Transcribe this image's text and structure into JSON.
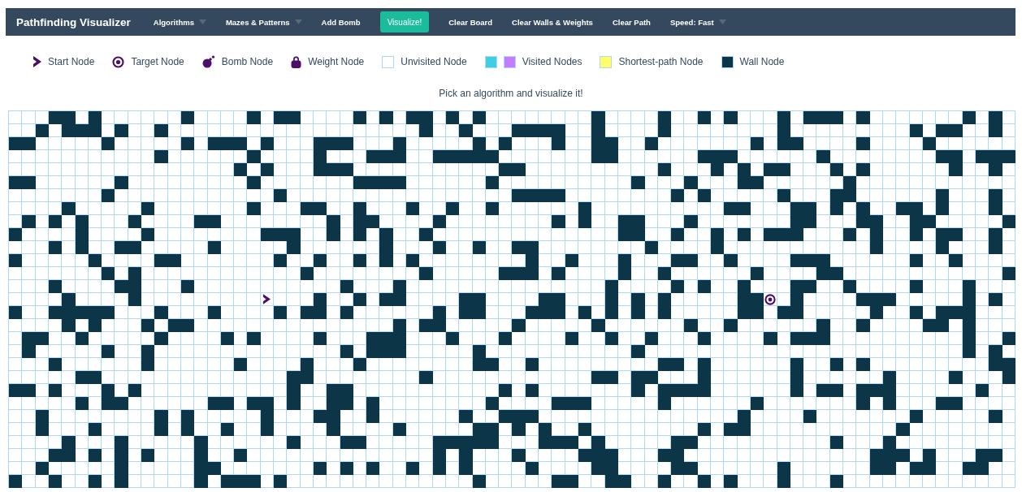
{
  "navbar": {
    "brand": "Pathfinding Visualizer",
    "items": [
      {
        "label": "Algorithms",
        "kind": "dropdown"
      },
      {
        "label": "Mazes & Patterns",
        "kind": "dropdown"
      },
      {
        "label": "Add Bomb",
        "kind": "link"
      },
      {
        "label": "Visualize!",
        "kind": "primary"
      },
      {
        "label": "Clear Board",
        "kind": "link"
      },
      {
        "label": "Clear Walls & Weights",
        "kind": "link"
      },
      {
        "label": "Clear Path",
        "kind": "link"
      },
      {
        "label": "Speed: Fast",
        "kind": "dropdown"
      }
    ]
  },
  "legend": [
    {
      "label": "Start Node",
      "kind": "start"
    },
    {
      "label": "Target Node",
      "kind": "target"
    },
    {
      "label": "Bomb Node",
      "kind": "bomb"
    },
    {
      "label": "Weight Node",
      "kind": "weight"
    },
    {
      "label": "Unvisited Node",
      "kind": "swatch",
      "swatches": [
        {
          "color": "#ffffff"
        }
      ]
    },
    {
      "label": "Visited Nodes",
      "kind": "swatch",
      "swatches": [
        {
          "color": "#40cee3"
        },
        {
          "color": "#c57dff"
        }
      ]
    },
    {
      "label": "Shortest-path Node",
      "kind": "swatch",
      "swatches": [
        {
          "color": "#fffe6a"
        }
      ]
    },
    {
      "label": "Wall Node",
      "kind": "swatch",
      "swatches": [
        {
          "color": "#0c3547"
        }
      ]
    }
  ],
  "instruction": "Pick an algorithm and visualize it!",
  "grid": {
    "rows": [
      [
        false,
        false,
        false,
        true,
        true,
        false,
        true,
        false,
        false,
        false,
        false,
        false,
        false,
        true,
        false,
        false,
        false,
        false,
        true,
        false,
        true,
        true,
        false,
        false,
        false,
        false,
        true,
        false,
        true,
        false,
        true,
        true,
        false,
        true,
        false,
        true,
        false,
        false,
        false,
        false,
        false,
        false,
        false,
        false,
        true,
        false,
        false,
        false,
        false,
        true,
        false,
        false,
        true,
        false,
        true,
        false,
        false,
        false,
        true,
        false,
        true,
        true,
        true,
        false,
        true,
        false,
        false,
        false,
        false,
        false,
        false,
        false,
        true,
        false,
        true,
        false
      ],
      [
        false,
        false,
        true,
        false,
        true,
        true,
        true,
        false,
        true,
        false,
        false,
        true,
        false,
        false,
        false,
        false,
        false,
        false,
        false,
        false,
        false,
        false,
        false,
        false,
        false,
        false,
        false,
        false,
        false,
        false,
        false,
        true,
        false,
        false,
        true,
        false,
        false,
        false,
        true,
        true,
        true,
        true,
        false,
        false,
        true,
        false,
        false,
        false,
        false,
        true,
        false,
        false,
        false,
        false,
        false,
        false,
        false,
        false,
        true,
        false,
        false,
        false,
        false,
        false,
        false,
        false,
        false,
        false,
        true,
        false,
        true,
        true,
        false,
        false,
        true,
        false
      ],
      [
        true,
        true,
        false,
        false,
        false,
        false,
        false,
        true,
        false,
        false,
        false,
        false,
        false,
        true,
        false,
        true,
        true,
        true,
        false,
        true,
        false,
        false,
        false,
        true,
        true,
        true,
        false,
        false,
        false,
        true,
        false,
        false,
        false,
        false,
        false,
        true,
        false,
        true,
        false,
        false,
        false,
        true,
        false,
        false,
        true,
        true,
        false,
        false,
        true,
        false,
        false,
        false,
        false,
        false,
        false,
        false,
        true,
        false,
        true,
        true,
        false,
        false,
        false,
        false,
        true,
        false,
        false,
        false,
        false,
        true,
        false,
        false,
        false,
        false,
        false,
        false
      ],
      [
        false,
        false,
        false,
        false,
        false,
        false,
        false,
        false,
        false,
        false,
        false,
        true,
        false,
        false,
        false,
        false,
        false,
        false,
        true,
        false,
        false,
        false,
        false,
        true,
        false,
        false,
        false,
        true,
        true,
        true,
        false,
        false,
        true,
        true,
        true,
        true,
        true,
        false,
        false,
        false,
        false,
        false,
        false,
        false,
        true,
        true,
        false,
        false,
        false,
        false,
        false,
        false,
        true,
        true,
        true,
        false,
        false,
        false,
        false,
        false,
        false,
        true,
        false,
        false,
        false,
        false,
        false,
        false,
        false,
        false,
        true,
        true,
        false,
        true,
        true,
        true
      ],
      [
        false,
        false,
        false,
        false,
        false,
        false,
        false,
        false,
        false,
        false,
        false,
        false,
        false,
        false,
        false,
        false,
        false,
        true,
        false,
        true,
        false,
        false,
        false,
        true,
        true,
        true,
        false,
        false,
        false,
        false,
        false,
        false,
        false,
        false,
        false,
        false,
        false,
        true,
        true,
        false,
        false,
        false,
        false,
        false,
        false,
        false,
        false,
        false,
        false,
        true,
        false,
        false,
        false,
        true,
        false,
        true,
        false,
        true,
        true,
        false,
        false,
        false,
        true,
        false,
        true,
        false,
        false,
        false,
        false,
        false,
        false,
        true,
        false,
        false,
        true,
        false
      ],
      [
        true,
        true,
        false,
        false,
        false,
        false,
        false,
        false,
        true,
        false,
        false,
        false,
        false,
        false,
        false,
        false,
        false,
        false,
        true,
        false,
        false,
        false,
        false,
        false,
        false,
        false,
        true,
        true,
        true,
        true,
        false,
        false,
        false,
        false,
        false,
        false,
        true,
        false,
        false,
        false,
        false,
        false,
        false,
        false,
        false,
        false,
        false,
        true,
        false,
        false,
        false,
        true,
        false,
        false,
        false,
        true,
        true,
        false,
        false,
        false,
        false,
        false,
        false,
        true,
        false,
        false,
        false,
        false,
        false,
        false,
        false,
        false,
        false,
        false,
        false,
        false
      ],
      [
        false,
        false,
        false,
        false,
        false,
        false,
        false,
        true,
        false,
        false,
        false,
        false,
        false,
        false,
        false,
        false,
        false,
        false,
        false,
        false,
        true,
        false,
        false,
        false,
        false,
        false,
        false,
        false,
        false,
        false,
        false,
        false,
        false,
        false,
        false,
        false,
        false,
        false,
        true,
        true,
        true,
        true,
        false,
        false,
        false,
        false,
        false,
        false,
        false,
        false,
        true,
        false,
        true,
        false,
        false,
        false,
        false,
        false,
        true,
        false,
        false,
        false,
        true,
        true,
        false,
        false,
        false,
        false,
        false,
        false,
        true,
        false,
        false,
        false,
        true,
        false
      ],
      [
        false,
        false,
        false,
        false,
        true,
        false,
        false,
        false,
        false,
        false,
        true,
        false,
        false,
        false,
        false,
        false,
        false,
        false,
        true,
        false,
        false,
        false,
        true,
        true,
        false,
        false,
        true,
        false,
        false,
        false,
        true,
        false,
        false,
        true,
        false,
        false,
        true,
        false,
        false,
        false,
        false,
        false,
        false,
        true,
        false,
        false,
        false,
        false,
        false,
        false,
        false,
        false,
        false,
        false,
        true,
        true,
        false,
        false,
        false,
        true,
        true,
        false,
        true,
        false,
        true,
        false,
        false,
        true,
        true,
        false,
        true,
        false,
        false,
        false,
        true,
        false
      ],
      [
        false,
        true,
        false,
        true,
        false,
        true,
        false,
        false,
        false,
        true,
        false,
        false,
        false,
        false,
        true,
        true,
        false,
        false,
        false,
        false,
        false,
        false,
        false,
        false,
        true,
        false,
        true,
        true,
        false,
        false,
        false,
        false,
        true,
        false,
        false,
        false,
        false,
        false,
        false,
        false,
        false,
        true,
        false,
        true,
        false,
        false,
        true,
        true,
        false,
        false,
        false,
        true,
        false,
        false,
        false,
        false,
        false,
        false,
        false,
        true,
        true,
        false,
        false,
        false,
        true,
        true,
        false,
        false,
        true,
        true,
        false,
        false,
        false,
        false,
        false,
        true
      ],
      [
        true,
        false,
        false,
        false,
        false,
        true,
        false,
        false,
        false,
        false,
        true,
        false,
        false,
        false,
        false,
        false,
        false,
        false,
        false,
        true,
        true,
        true,
        false,
        false,
        true,
        false,
        true,
        false,
        true,
        false,
        false,
        true,
        false,
        false,
        false,
        false,
        false,
        false,
        false,
        false,
        false,
        false,
        false,
        false,
        false,
        false,
        true,
        true,
        false,
        false,
        true,
        false,
        false,
        true,
        false,
        true,
        false,
        true,
        true,
        true,
        false,
        false,
        false,
        true,
        false,
        true,
        false,
        false,
        true,
        false,
        true,
        true,
        false,
        false,
        true,
        false
      ],
      [
        false,
        false,
        false,
        true,
        false,
        true,
        false,
        false,
        true,
        true,
        false,
        false,
        false,
        false,
        false,
        true,
        false,
        false,
        false,
        false,
        false,
        true,
        false,
        false,
        false,
        false,
        false,
        false,
        true,
        false,
        false,
        false,
        true,
        false,
        false,
        true,
        false,
        false,
        true,
        true,
        false,
        false,
        false,
        false,
        false,
        false,
        false,
        false,
        true,
        false,
        false,
        false,
        false,
        true,
        false,
        false,
        false,
        false,
        false,
        false,
        false,
        false,
        false,
        false,
        false,
        true,
        false,
        false,
        false,
        false,
        true,
        false,
        false,
        false,
        true,
        false
      ],
      [
        true,
        false,
        false,
        false,
        false,
        false,
        true,
        false,
        false,
        false,
        false,
        true,
        true,
        false,
        false,
        false,
        false,
        false,
        false,
        false,
        true,
        false,
        false,
        true,
        false,
        false,
        true,
        false,
        true,
        false,
        true,
        false,
        false,
        false,
        false,
        false,
        false,
        false,
        false,
        true,
        false,
        false,
        true,
        false,
        false,
        false,
        true,
        false,
        false,
        false,
        true,
        true,
        false,
        false,
        true,
        false,
        false,
        false,
        false,
        true,
        true,
        true,
        false,
        false,
        false,
        false,
        false,
        false,
        true,
        false,
        false,
        true,
        false,
        false,
        false,
        false
      ],
      [
        false,
        false,
        false,
        false,
        false,
        false,
        false,
        true,
        false,
        true,
        false,
        false,
        false,
        false,
        false,
        false,
        false,
        false,
        false,
        false,
        false,
        false,
        true,
        false,
        false,
        false,
        false,
        false,
        false,
        false,
        false,
        true,
        false,
        false,
        false,
        false,
        false,
        true,
        true,
        true,
        false,
        true,
        false,
        false,
        false,
        false,
        true,
        false,
        false,
        true,
        false,
        false,
        false,
        false,
        false,
        false,
        true,
        false,
        false,
        false,
        false,
        true,
        true,
        false,
        false,
        false,
        false,
        false,
        false,
        false,
        false,
        false,
        false,
        false,
        false,
        true
      ],
      [
        false,
        false,
        false,
        true,
        false,
        false,
        false,
        false,
        true,
        true,
        false,
        false,
        false,
        true,
        false,
        false,
        false,
        false,
        false,
        false,
        false,
        false,
        false,
        false,
        false,
        true,
        false,
        false,
        false,
        true,
        false,
        false,
        false,
        false,
        false,
        false,
        false,
        false,
        false,
        false,
        false,
        false,
        false,
        false,
        false,
        true,
        false,
        false,
        false,
        false,
        true,
        false,
        true,
        false,
        false,
        true,
        false,
        false,
        false,
        true,
        true,
        false,
        false,
        true,
        false,
        false,
        false,
        false,
        true,
        false,
        false,
        false,
        true,
        false,
        false,
        false
      ],
      [
        false,
        false,
        false,
        false,
        true,
        false,
        false,
        false,
        false,
        true,
        false,
        false,
        false,
        false,
        false,
        false,
        false,
        false,
        false,
        {
          "kind": "start"
        },
        false,
        false,
        false,
        true,
        false,
        false,
        true,
        false,
        true,
        true,
        false,
        false,
        false,
        false,
        true,
        true,
        false,
        false,
        false,
        false,
        true,
        true,
        false,
        false,
        false,
        true,
        false,
        true,
        false,
        true,
        false,
        false,
        false,
        false,
        false,
        true,
        true,
        {
          "kind": "target"
        },
        false,
        true,
        false,
        false,
        false,
        false,
        true,
        true,
        true,
        false,
        false,
        false,
        false,
        false,
        true,
        false,
        true,
        false
      ],
      [
        true,
        false,
        false,
        true,
        true,
        true,
        true,
        true,
        false,
        false,
        false,
        true,
        false,
        false,
        false,
        true,
        false,
        false,
        false,
        false,
        true,
        false,
        true,
        true,
        false,
        true,
        false,
        false,
        false,
        false,
        false,
        false,
        true,
        false,
        true,
        true,
        false,
        false,
        false,
        true,
        true,
        true,
        false,
        true,
        false,
        true,
        false,
        true,
        false,
        true,
        false,
        false,
        false,
        false,
        false,
        true,
        true,
        false,
        true,
        true,
        false,
        false,
        false,
        false,
        false,
        true,
        false,
        false,
        true,
        false,
        true,
        true,
        true,
        false,
        false,
        false
      ],
      [
        false,
        false,
        false,
        false,
        true,
        false,
        true,
        false,
        false,
        false,
        true,
        false,
        true,
        true,
        false,
        false,
        false,
        false,
        false,
        false,
        false,
        false,
        false,
        false,
        false,
        false,
        false,
        false,
        false,
        true,
        false,
        true,
        true,
        false,
        false,
        false,
        false,
        false,
        true,
        false,
        false,
        false,
        false,
        false,
        true,
        false,
        false,
        false,
        false,
        false,
        false,
        true,
        false,
        false,
        true,
        false,
        false,
        false,
        false,
        false,
        false,
        true,
        false,
        false,
        true,
        false,
        false,
        false,
        false,
        true,
        true,
        false,
        true,
        false,
        false,
        false
      ],
      [
        false,
        true,
        true,
        false,
        false,
        true,
        false,
        false,
        false,
        false,
        false,
        true,
        false,
        false,
        false,
        false,
        true,
        false,
        true,
        false,
        false,
        false,
        false,
        true,
        false,
        false,
        false,
        true,
        true,
        true,
        false,
        false,
        false,
        true,
        false,
        false,
        false,
        true,
        false,
        false,
        false,
        false,
        true,
        false,
        false,
        true,
        false,
        false,
        true,
        false,
        false,
        false,
        true,
        false,
        false,
        false,
        false,
        true,
        false,
        true,
        true,
        true,
        false,
        false,
        false,
        false,
        false,
        false,
        false,
        false,
        false,
        false,
        true,
        false,
        false,
        true
      ],
      [
        false,
        true,
        false,
        false,
        false,
        false,
        false,
        true,
        false,
        false,
        true,
        false,
        false,
        false,
        false,
        false,
        false,
        false,
        false,
        false,
        false,
        false,
        false,
        false,
        false,
        true,
        false,
        true,
        true,
        true,
        false,
        false,
        false,
        false,
        false,
        true,
        false,
        false,
        false,
        false,
        false,
        false,
        false,
        false,
        false,
        false,
        false,
        true,
        false,
        false,
        false,
        false,
        false,
        false,
        false,
        false,
        false,
        false,
        false,
        false,
        false,
        false,
        false,
        false,
        false,
        false,
        false,
        false,
        false,
        false,
        false,
        false,
        true,
        false,
        true,
        false
      ],
      [
        false,
        false,
        false,
        true,
        false,
        false,
        false,
        false,
        false,
        false,
        true,
        false,
        false,
        false,
        false,
        false,
        false,
        true,
        false,
        false,
        false,
        false,
        true,
        false,
        false,
        false,
        true,
        false,
        false,
        false,
        false,
        false,
        false,
        false,
        false,
        true,
        true,
        false,
        false,
        true,
        false,
        false,
        false,
        false,
        false,
        false,
        false,
        false,
        false,
        true,
        true,
        false,
        true,
        false,
        false,
        false,
        false,
        false,
        false,
        true,
        false,
        false,
        true,
        false,
        true,
        false,
        false,
        false,
        false,
        false,
        false,
        false,
        false,
        false,
        true,
        true
      ],
      [
        false,
        false,
        false,
        false,
        false,
        true,
        true,
        false,
        false,
        false,
        false,
        false,
        false,
        false,
        false,
        false,
        false,
        false,
        false,
        false,
        false,
        true,
        true,
        false,
        false,
        false,
        false,
        false,
        false,
        false,
        false,
        true,
        false,
        false,
        false,
        false,
        false,
        false,
        false,
        false,
        false,
        false,
        false,
        false,
        true,
        true,
        false,
        true,
        true,
        false,
        false,
        false,
        true,
        false,
        false,
        false,
        false,
        false,
        false,
        true,
        false,
        false,
        false,
        false,
        false,
        false,
        true,
        false,
        false,
        false,
        false,
        true,
        false,
        false,
        false,
        true
      ],
      [
        true,
        true,
        false,
        true,
        false,
        false,
        false,
        true,
        false,
        true,
        false,
        false,
        false,
        false,
        false,
        false,
        false,
        false,
        false,
        false,
        false,
        true,
        false,
        false,
        true,
        true,
        false,
        false,
        false,
        false,
        false,
        false,
        false,
        false,
        false,
        false,
        false,
        true,
        false,
        true,
        false,
        false,
        false,
        false,
        false,
        false,
        false,
        true,
        false,
        true,
        true,
        true,
        true,
        false,
        false,
        false,
        false,
        false,
        false,
        true,
        false,
        true,
        true,
        false,
        true,
        true,
        true,
        false,
        false,
        false,
        false,
        false,
        false,
        true,
        false,
        false
      ],
      [
        false,
        false,
        false,
        false,
        false,
        true,
        false,
        true,
        true,
        false,
        false,
        false,
        false,
        false,
        false,
        true,
        true,
        false,
        true,
        true,
        false,
        true,
        false,
        false,
        true,
        true,
        false,
        true,
        false,
        false,
        false,
        false,
        false,
        false,
        false,
        false,
        true,
        false,
        false,
        false,
        false,
        true,
        true,
        true,
        false,
        false,
        false,
        false,
        false,
        true,
        false,
        false,
        false,
        false,
        false,
        false,
        true,
        false,
        false,
        false,
        false,
        false,
        false,
        false,
        true,
        false,
        true,
        false,
        false,
        false,
        true,
        true,
        false,
        false,
        false,
        false
      ],
      [
        false,
        false,
        true,
        false,
        false,
        false,
        false,
        false,
        false,
        false,
        false,
        true,
        false,
        true,
        false,
        false,
        false,
        false,
        false,
        true,
        false,
        false,
        false,
        true,
        true,
        false,
        false,
        true,
        false,
        false,
        false,
        false,
        false,
        false,
        true,
        false,
        false,
        true,
        true,
        true,
        false,
        false,
        false,
        false,
        false,
        false,
        false,
        false,
        false,
        false,
        false,
        false,
        false,
        false,
        false,
        true,
        false,
        false,
        false,
        false,
        true,
        false,
        false,
        false,
        false,
        false,
        false,
        false,
        true,
        false,
        false,
        false,
        false,
        false,
        true,
        false
      ],
      [
        false,
        false,
        true,
        false,
        false,
        false,
        true,
        false,
        false,
        false,
        false,
        true,
        false,
        true,
        false,
        false,
        true,
        false,
        false,
        true,
        false,
        false,
        false,
        false,
        true,
        false,
        false,
        false,
        false,
        true,
        false,
        false,
        false,
        false,
        false,
        true,
        true,
        false,
        true,
        false,
        true,
        false,
        false,
        true,
        false,
        false,
        false,
        false,
        false,
        false,
        false,
        false,
        true,
        false,
        true,
        true,
        false,
        false,
        false,
        false,
        false,
        false,
        false,
        false,
        false,
        false,
        false,
        true,
        false,
        false,
        false,
        false,
        false,
        false,
        false,
        false
      ],
      [
        false,
        false,
        false,
        false,
        true,
        false,
        false,
        false,
        true,
        false,
        false,
        false,
        false,
        false,
        true,
        false,
        false,
        false,
        false,
        false,
        false,
        true,
        false,
        false,
        false,
        true,
        true,
        false,
        false,
        false,
        false,
        false,
        true,
        true,
        true,
        true,
        true,
        false,
        false,
        false,
        true,
        true,
        true,
        false,
        true,
        false,
        false,
        false,
        false,
        false,
        true,
        true,
        false,
        false,
        false,
        false,
        false,
        false,
        false,
        false,
        false,
        false,
        true,
        false,
        false,
        false,
        true,
        false,
        false,
        false,
        false,
        false,
        false,
        false,
        false,
        false
      ],
      [
        false,
        false,
        false,
        true,
        true,
        false,
        true,
        false,
        true,
        false,
        true,
        false,
        false,
        false,
        true,
        false,
        false,
        true,
        false,
        false,
        false,
        false,
        false,
        false,
        false,
        false,
        false,
        false,
        false,
        false,
        false,
        false,
        true,
        false,
        true,
        false,
        false,
        false,
        true,
        false,
        false,
        false,
        false,
        true,
        true,
        true,
        false,
        false,
        false,
        true,
        true,
        false,
        false,
        false,
        false,
        false,
        false,
        false,
        false,
        false,
        false,
        false,
        false,
        false,
        false,
        true,
        true,
        true,
        false,
        true,
        false,
        false,
        false,
        true,
        true,
        false
      ],
      [
        false,
        false,
        true,
        false,
        false,
        false,
        false,
        false,
        true,
        false,
        false,
        false,
        false,
        false,
        true,
        true,
        false,
        false,
        false,
        false,
        false,
        false,
        false,
        true,
        false,
        true,
        false,
        true,
        false,
        false,
        true,
        false,
        true,
        false,
        true,
        false,
        false,
        false,
        false,
        true,
        false,
        false,
        false,
        false,
        true,
        true,
        false,
        false,
        false,
        false,
        true,
        true,
        false,
        false,
        false,
        false,
        false,
        false,
        true,
        false,
        false,
        false,
        false,
        false,
        false,
        true,
        true,
        false,
        true,
        true,
        false,
        false,
        true,
        true,
        false,
        false
      ],
      [
        true,
        false,
        false,
        true,
        false,
        false,
        true,
        false,
        true,
        false,
        false,
        false,
        false,
        false,
        true,
        false,
        true,
        true,
        true,
        false,
        true,
        false,
        false,
        false,
        false,
        false,
        false,
        false,
        false,
        false,
        false,
        false,
        false,
        false,
        false,
        true,
        false,
        false,
        false,
        false,
        false,
        true,
        true,
        false,
        false,
        true,
        true,
        false,
        false,
        true,
        false,
        false,
        true,
        false,
        true,
        false,
        false,
        false,
        true,
        false,
        false,
        false,
        true,
        false,
        false,
        false,
        false,
        false,
        false,
        false,
        false,
        false,
        false,
        false,
        false,
        false
      ]
    ]
  }
}
